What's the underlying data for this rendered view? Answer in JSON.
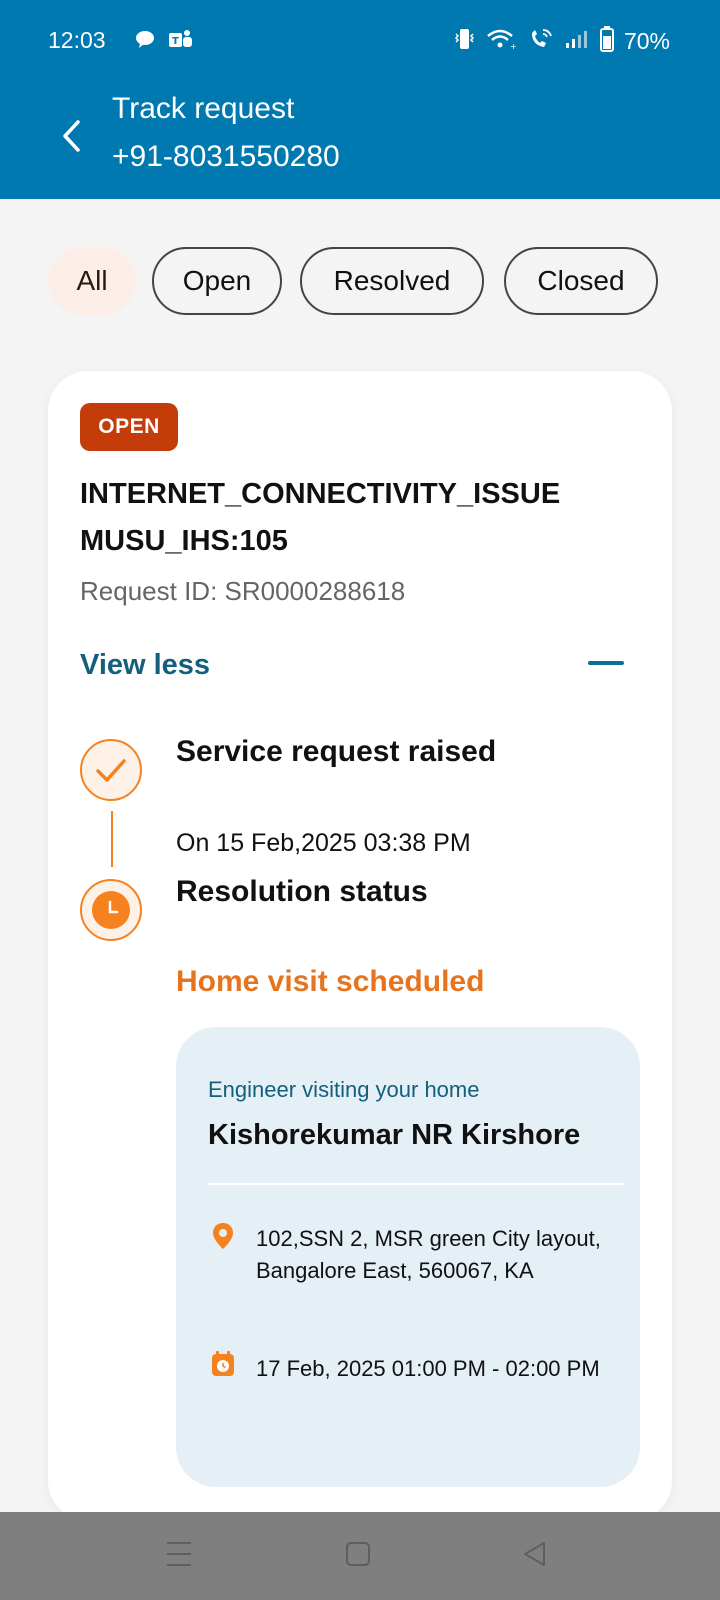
{
  "status_bar": {
    "time": "12:03",
    "battery": "70%",
    "left_icons": [
      "chat-bubble-icon",
      "teams-icon"
    ],
    "right_icons": [
      "vibrate-icon",
      "wifi-icon",
      "wifi-call-icon",
      "signal-icon",
      "battery-icon"
    ]
  },
  "header": {
    "title": "Track request",
    "subtitle": "+91-8031550280",
    "background": "#0078b0"
  },
  "filters": {
    "active": "All",
    "items": [
      {
        "label": "All"
      },
      {
        "label": "Open"
      },
      {
        "label": "Resolved"
      },
      {
        "label": "Closed"
      }
    ]
  },
  "request": {
    "status_badge": "OPEN",
    "title_line1": "INTERNET_CONNECTIVITY_ISSUE",
    "title_line2": "MUSU_IHS:105",
    "request_id": "Request ID: SR0000288618",
    "toggle_label": "View less",
    "timeline": {
      "step1_title": "Service request raised",
      "step1_date": "On 15 Feb,2025 03:38 PM",
      "step2_title": "Resolution status",
      "step2_status": "Home visit scheduled"
    },
    "engineer": {
      "caption": "Engineer visiting your home",
      "name": "Kishorekumar NR Kirshore",
      "address": "102,SSN 2, MSR green City layout, Bangalore East, 560067, KA",
      "slot": "17 Feb, 2025 01:00 PM - 02:00 PM"
    }
  },
  "colors": {
    "accent_orange": "#f5821f",
    "badge_red": "#c43c09",
    "link_teal": "#135f7c"
  }
}
